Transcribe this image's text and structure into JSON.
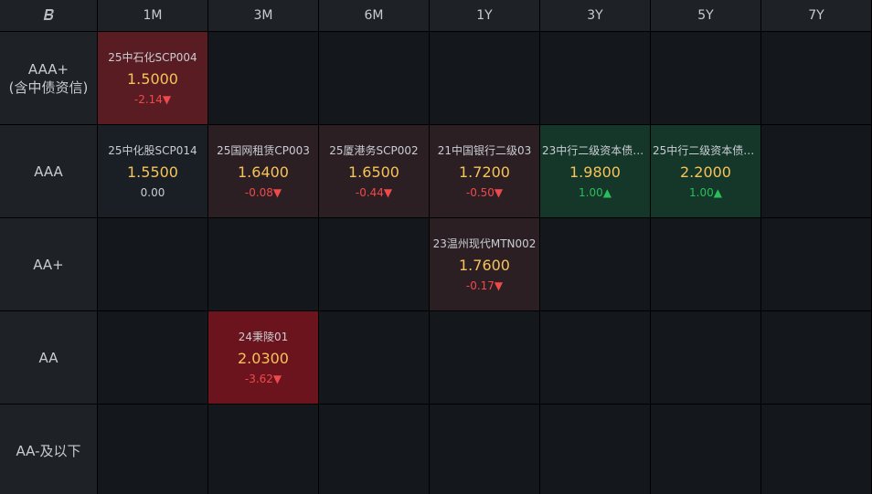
{
  "corner_logo": "B",
  "columns": [
    "1M",
    "3M",
    "6M",
    "1Y",
    "3Y",
    "5Y",
    "7Y"
  ],
  "rows": [
    {
      "label_lines": [
        "AAA+",
        "(含中债资信)"
      ],
      "cells": [
        {
          "name": "25中石化SCP004",
          "rate": "1.5000",
          "change": "-2.14▼",
          "dir": "down",
          "tone": "red-strong"
        },
        null,
        null,
        null,
        null,
        null,
        null
      ]
    },
    {
      "label_lines": [
        "AAA"
      ],
      "cells": [
        {
          "name": "25中化股SCP014",
          "rate": "1.5500",
          "change": "0.00",
          "dir": "flat",
          "tone": "neutral"
        },
        {
          "name": "25国网租赁CP003",
          "rate": "1.6400",
          "change": "-0.08▼",
          "dir": "down",
          "tone": "red-soft"
        },
        {
          "name": "25厦港务SCP002",
          "rate": "1.6500",
          "change": "-0.44▼",
          "dir": "down",
          "tone": "red-soft"
        },
        {
          "name": "21中国银行二级03",
          "rate": "1.7200",
          "change": "-0.50▼",
          "dir": "down",
          "tone": "red-soft"
        },
        {
          "name": "23中行二级资本债0...",
          "rate": "1.9800",
          "change": "1.00▲",
          "dir": "up",
          "tone": "green"
        },
        {
          "name": "25中行二级资本债0...",
          "rate": "2.2000",
          "change": "1.00▲",
          "dir": "up",
          "tone": "green"
        },
        null
      ]
    },
    {
      "label_lines": [
        "AA+"
      ],
      "cells": [
        null,
        null,
        null,
        {
          "name": "23温州现代MTN002",
          "rate": "1.7600",
          "change": "-0.17▼",
          "dir": "down",
          "tone": "red-soft"
        },
        null,
        null,
        null
      ]
    },
    {
      "label_lines": [
        "AA"
      ],
      "cells": [
        null,
        {
          "name": "24秉陵01",
          "rate": "2.0300",
          "change": "-3.62▼",
          "dir": "down",
          "tone": "red-bright"
        },
        null,
        null,
        null,
        null,
        null
      ]
    },
    {
      "label_lines": [
        "AA-及以下"
      ],
      "cells": [
        null,
        null,
        null,
        null,
        null,
        null,
        null
      ]
    }
  ],
  "colors": {
    "rate": "#f5c35a",
    "down": "#f0494c",
    "up": "#2bbd5a",
    "header_bg": "#1e2226",
    "cell_bg": "#14181d"
  }
}
